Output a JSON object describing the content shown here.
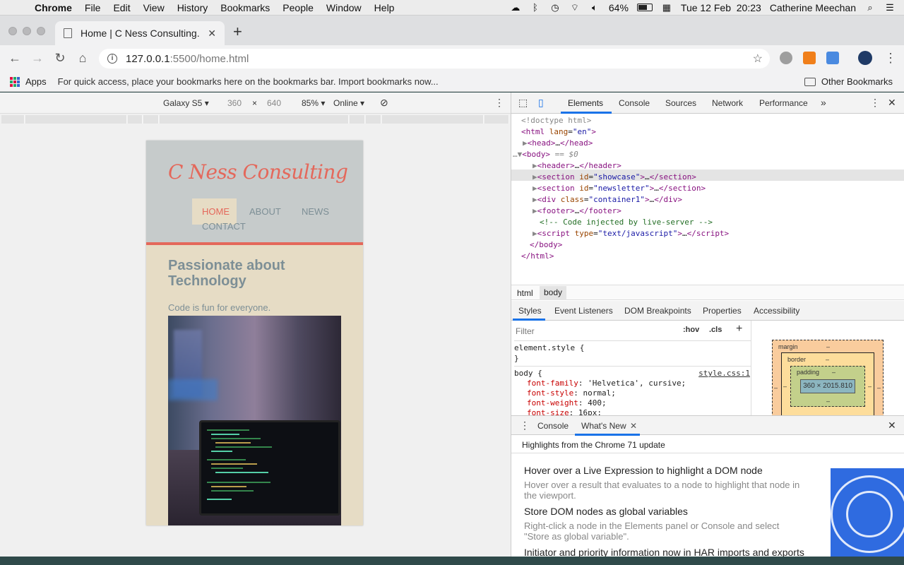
{
  "menubar": {
    "app": "Chrome",
    "items": [
      "File",
      "Edit",
      "View",
      "History",
      "Bookmarks",
      "People",
      "Window",
      "Help"
    ],
    "battery": "64%",
    "datetime": "Tue 12 Feb  20:23",
    "user": "Catherine Meechan"
  },
  "tab": {
    "title": "Home | C Ness Consulting."
  },
  "address": {
    "host": "127.0.0.1",
    "path": ":5500/home.html"
  },
  "bookmarks": {
    "apps": "Apps",
    "hint": "For quick access, place your bookmarks here on the bookmarks bar. Import bookmarks now...",
    "other": "Other Bookmarks"
  },
  "device_toolbar": {
    "device": "Galaxy S5",
    "width": "360",
    "times": "×",
    "height": "640",
    "zoom": "85%",
    "network": "Online"
  },
  "site": {
    "logo": "C Ness Consulting",
    "nav": [
      "HOME",
      "ABOUT",
      "NEWS",
      "CONTACT"
    ],
    "hero_title": "Passionate about Technology",
    "hero_sub": "Code is fun for everyone."
  },
  "devtools": {
    "tabs": [
      "Elements",
      "Console",
      "Sources",
      "Network",
      "Performance"
    ],
    "dom": {
      "doctype": "<!doctype html>",
      "body_marker": "== $0",
      "comment": "<!-- Code injected by live-server -->"
    },
    "crumbs": [
      "html",
      "body"
    ],
    "style_tabs": [
      "Styles",
      "Event Listeners",
      "DOM Breakpoints",
      "Properties",
      "Accessibility"
    ],
    "filter_placeholder": "Filter",
    "hov": ":hov",
    "cls": ".cls",
    "element_style": "element.style {",
    "close_brace": "}",
    "body_selector": "body {",
    "source_link": "style.css:1",
    "rules": [
      {
        "prop": "font-family",
        "value": "'Helvetica', cursive;"
      },
      {
        "prop": "font-style",
        "value": "normal;"
      },
      {
        "prop": "font-weight",
        "value": "400;"
      },
      {
        "prop": "font-size",
        "value": "16px;"
      }
    ],
    "boxmodel": {
      "margin": "margin",
      "border": "border",
      "padding": "padding",
      "content": "360 × 2015.810",
      "dash": "–"
    },
    "drawer_tabs": [
      "Console",
      "What's New"
    ],
    "highlights": "Highlights from the Chrome 71 update",
    "whatsnew": [
      {
        "title": "Hover over a Live Expression to highlight a DOM node",
        "body": "Hover over a result that evaluates to a node to highlight that node in the viewport."
      },
      {
        "title": "Store DOM nodes as global variables",
        "body": "Right-click a node in the Elements panel or Console and select \"Store as global variable\"."
      },
      {
        "title": "Initiator and priority information now in HAR imports and exports",
        "body": ""
      }
    ]
  }
}
